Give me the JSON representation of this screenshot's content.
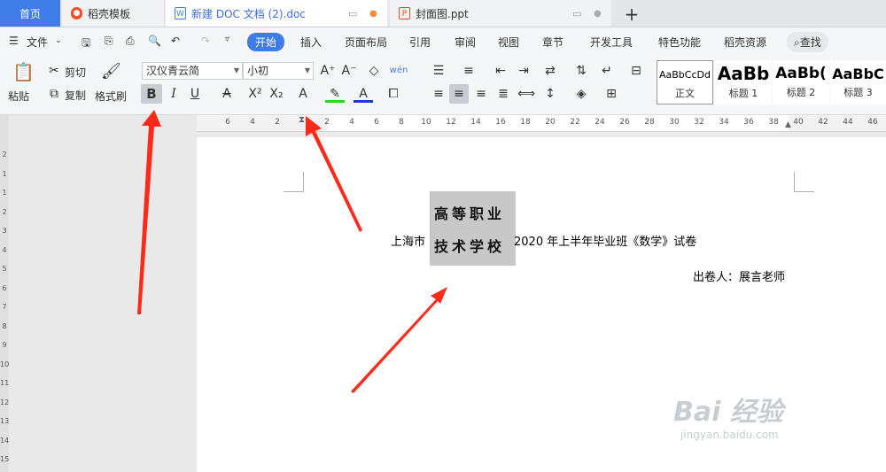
{
  "tabs": {
    "home": "首页",
    "template": "稻壳模板",
    "doc": "新建 DOC 文档 (2).doc",
    "ppt": "封面图.ppt",
    "add": "+"
  },
  "menu": {
    "file": "文件",
    "items": [
      "开始",
      "插入",
      "页面布局",
      "引用",
      "审阅",
      "视图",
      "章节",
      "开发工具",
      "特色功能",
      "稻壳资源"
    ],
    "search": "查找"
  },
  "ribbon": {
    "paste": "粘贴",
    "cut": "剪切",
    "copy": "复制",
    "format_painter": "格式刷",
    "font_name": "汉仪青云简",
    "font_size": "小初",
    "bold": "B",
    "italic": "I",
    "underline": "U",
    "styles": [
      {
        "sample": "AaBbCcDd",
        "label": "正文"
      },
      {
        "sample": "AaBb",
        "label": "标题 1"
      },
      {
        "sample": "AaBb(",
        "label": "标题 2"
      },
      {
        "sample": "AaBbC",
        "label": "标题 3"
      }
    ]
  },
  "ruler": {
    "ticks": [
      "6",
      "4",
      "2",
      "",
      "2",
      "4",
      "6",
      "8",
      "10",
      "12",
      "14",
      "16",
      "18",
      "20",
      "22",
      "24",
      "26",
      "28",
      "30",
      "32",
      "34",
      "36",
      "38",
      "40",
      "42",
      "44",
      "46"
    ],
    "vticks": [
      "2",
      "1",
      "1",
      "2",
      "3",
      "4",
      "5",
      "6",
      "7",
      "8",
      "9",
      "10",
      "11",
      "12",
      "13",
      "14",
      "15"
    ]
  },
  "document": {
    "prefix": "上海市",
    "highlight_line1": "高等职业",
    "highlight_line2": "技术学校",
    "suffix": "2020 年上半年毕业班《数学》试卷",
    "author": "出卷人：展言老师"
  },
  "watermark": {
    "brand": "Bai 经验",
    "url": "jingyan.baidu.com"
  },
  "colors": {
    "accent": "#3f7ce8",
    "arrow": "#ff2a1a"
  }
}
